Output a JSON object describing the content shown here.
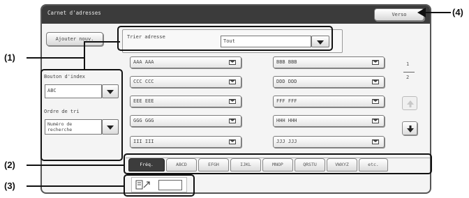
{
  "window": {
    "title": "Carnet d'adresses"
  },
  "toolbar": {
    "verso_label": "Verso",
    "add_new_label": "Ajouter nouv."
  },
  "sort": {
    "label": "Trier adresse",
    "selected": "Tout"
  },
  "index": {
    "label": "Bouton d'index",
    "selected": "ABC"
  },
  "order": {
    "label": "Ordre de tri",
    "selected": "Numéro de recherche"
  },
  "entries": [
    {
      "name": "AAA AAA"
    },
    {
      "name": "BBB BBB"
    },
    {
      "name": "CCC CCC"
    },
    {
      "name": "DDD DDD"
    },
    {
      "name": "EEE EEE"
    },
    {
      "name": "FFF FFF"
    },
    {
      "name": "GGG GGG"
    },
    {
      "name": "HHH HHH"
    },
    {
      "name": "III III"
    },
    {
      "name": "JJJ JJJ"
    }
  ],
  "pager": {
    "current": "1",
    "total": "2"
  },
  "tabs": [
    "Fréq.",
    "ABCD",
    "EFGH",
    "IJKL",
    "MNOP",
    "QRSTU",
    "VWXYZ",
    "etc."
  ],
  "callouts": {
    "c1": "(1)",
    "c2": "(2)",
    "c3": "(3)",
    "c4": "(4)"
  },
  "colors": {
    "titlebar": "#3b3b3b",
    "panel": "#f4f4f4",
    "active_tab": "#3c3c3c",
    "callout": "#111111"
  },
  "icons": {
    "mail": "mail-icon",
    "arrow_up": "arrow-up-icon",
    "arrow_down": "arrow-down-icon",
    "global_address": "global-address-icon",
    "dropdown": "chevron-down-icon"
  }
}
